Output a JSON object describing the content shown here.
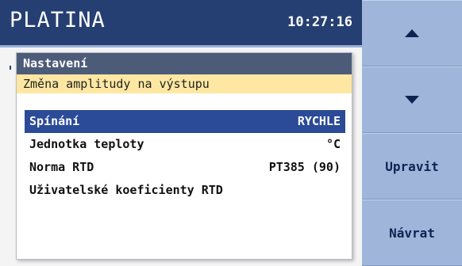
{
  "header": {
    "title": "PLATINA",
    "time": "10:27:16"
  },
  "dialog": {
    "title": "Nastavení",
    "subtitle": "Změna amplitudy na výstupu",
    "items": [
      {
        "label": "Spínání",
        "value": "RYCHLE",
        "selected": true
      },
      {
        "label": "Jednotka teploty",
        "value": "°C",
        "selected": false
      },
      {
        "label": "Norma RTD",
        "value": "PT385 (90)",
        "selected": false
      },
      {
        "label": "Uživatelské koeficienty RTD",
        "value": "",
        "selected": false
      }
    ]
  },
  "side_buttons": {
    "up_icon": "arrow-up-icon",
    "down_icon": "arrow-down-icon",
    "edit_label": "Upravit",
    "back_label": "Návrat"
  },
  "colors": {
    "titlebar": "#263f73",
    "selection": "#2b4a97",
    "dialog_header": "#4c5b78",
    "subheader": "#fde7a2",
    "side_panel": "#9fb6da"
  }
}
